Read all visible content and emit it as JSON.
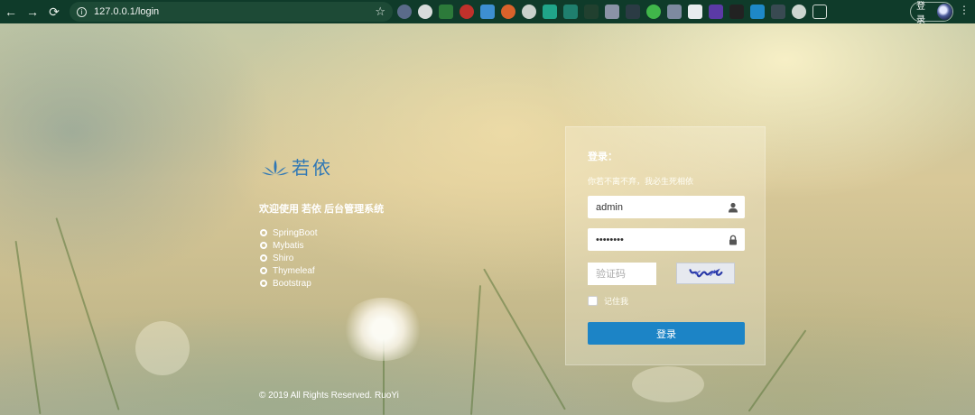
{
  "browser": {
    "url": "127.0.0.1/login",
    "sign_in_label": "登录"
  },
  "intro": {
    "logo_text": "若依",
    "welcome": "欢迎使用 若依 后台管理系统",
    "tech": [
      "SpringBoot",
      "Mybatis",
      "Shiro",
      "Thymeleaf",
      "Bootstrap"
    ]
  },
  "login": {
    "title": "登录：",
    "subtitle": "你若不离不弃，我必生死相依",
    "username_value": "admin",
    "password_value": "admin123",
    "captcha_placeholder": "验证码",
    "remember_label": "记住我",
    "submit_label": "登录"
  },
  "footer": {
    "copyright": "© 2019 All Rights Reserved. RuoYi"
  },
  "colors": {
    "accent": "#1c84c6",
    "browser_bar": "#0f3b2a",
    "logo": "#2f77b5"
  },
  "icons": {
    "back": "arrow-left-icon",
    "forward": "arrow-right-icon",
    "reload": "reload-icon",
    "user": "user-icon",
    "lock": "lock-icon"
  }
}
